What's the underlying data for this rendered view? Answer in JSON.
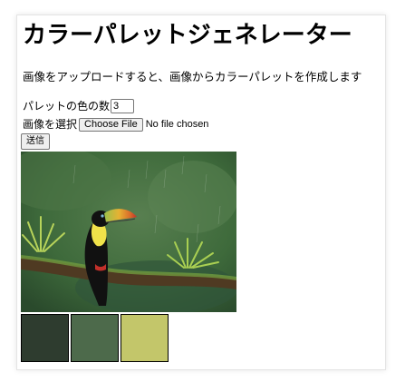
{
  "page": {
    "title": "カラーパレットジェネレーター",
    "description": "画像をアップロードすると、画像からカラーパレットを作成します"
  },
  "form": {
    "count_label": "パレットの色の数",
    "count_value": "3",
    "file_label": "画像を選択",
    "file_button_label": "Choose File",
    "file_status": "No file chosen",
    "submit_label": "送信"
  },
  "preview": {
    "icon": "toucan-photo",
    "colors": {
      "background": "#3e6a3b",
      "branch": "#4f3a22",
      "beak": "#d8c640",
      "body": "#111111"
    }
  },
  "palette": [
    {
      "color": "#2e3c2f"
    },
    {
      "color": "#4d6a4b"
    },
    {
      "color": "#c3c66a"
    }
  ]
}
